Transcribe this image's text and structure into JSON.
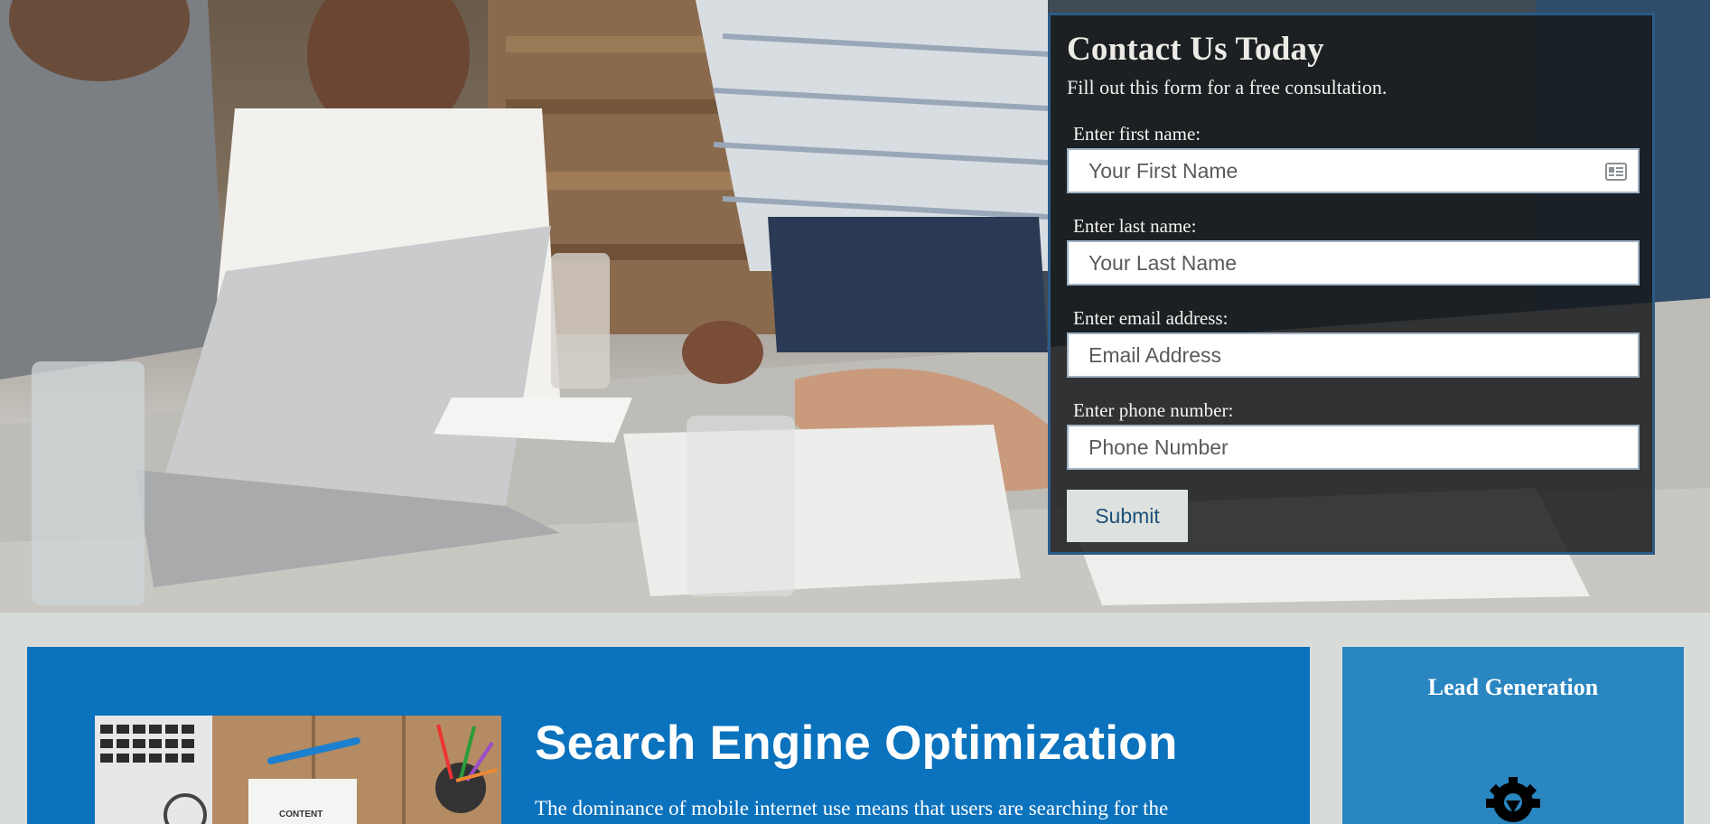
{
  "contact": {
    "title": "Contact Us Today",
    "subtitle": "Fill out this form for a free consultation.",
    "fields": [
      {
        "label": "Enter first name:",
        "placeholder": "Your First Name",
        "value": ""
      },
      {
        "label": "Enter last name:",
        "placeholder": "Your Last Name",
        "value": ""
      },
      {
        "label": "Enter email address:",
        "placeholder": "Email Address",
        "value": ""
      },
      {
        "label": "Enter phone number:",
        "placeholder": "Phone Number",
        "value": ""
      }
    ],
    "submit_label": "Submit"
  },
  "seo": {
    "title": "Search Engine Optimization",
    "text": "The dominance of mobile internet use means that users are searching for the",
    "thumb_caption": "CONTENT"
  },
  "lead": {
    "title": "Lead Generation",
    "icon": "gear-download-icon"
  },
  "colors": {
    "page_bg": "#d8dcd9",
    "form_border": "#2b5c86",
    "seo_bg": "#0b72bd",
    "lead_bg": "#2a86c1",
    "submit_text": "#1c4f79"
  }
}
